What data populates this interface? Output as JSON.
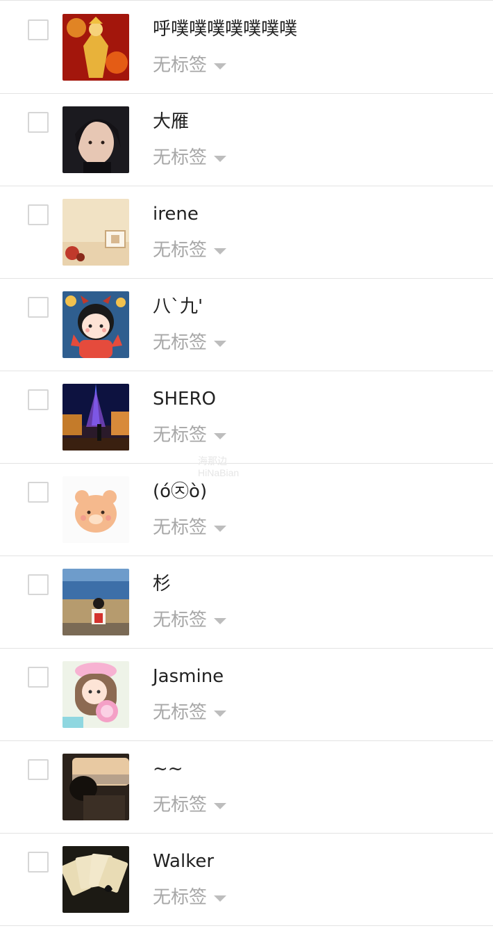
{
  "contacts": [
    {
      "name": "呼噗噗噗噗噗噗噗",
      "tag_label": "无标签",
      "avatar_icon": "golden-warrior-avatar",
      "avatar_colors": [
        "#a3160c",
        "#e8b23a"
      ]
    },
    {
      "name": "大雁",
      "tag_label": "无标签",
      "avatar_icon": "man-portrait-avatar",
      "avatar_colors": [
        "#1b1a1f",
        "#e7c7b4"
      ]
    },
    {
      "name": "irene",
      "tag_label": "无标签",
      "avatar_icon": "room-photo-avatar",
      "avatar_colors": [
        "#f1e2c4",
        "#c0392b"
      ]
    },
    {
      "name": "八`九'",
      "tag_label": "无标签",
      "avatar_icon": "cartoon-girl-avatar",
      "avatar_colors": [
        "#2f5e8f",
        "#e54b3c"
      ]
    },
    {
      "name": "SHERO",
      "tag_label": "无标签",
      "avatar_icon": "night-tower-avatar",
      "avatar_colors": [
        "#0d1240",
        "#c47b2a"
      ]
    },
    {
      "name": "(ó㉨ò)",
      "tag_label": "无标签",
      "avatar_icon": "bear-face-avatar",
      "avatar_colors": [
        "#fbfbfb",
        "#f5b98d"
      ]
    },
    {
      "name": "杉",
      "tag_label": "无标签",
      "avatar_icon": "seaside-photo-avatar",
      "avatar_colors": [
        "#3d6fa8",
        "#b69b6e"
      ]
    },
    {
      "name": "Jasmine",
      "tag_label": "无标签",
      "avatar_icon": "candy-girl-avatar",
      "avatar_colors": [
        "#eef3e8",
        "#f4a0c6"
      ]
    },
    {
      "name": "~~",
      "tag_label": "无标签",
      "avatar_icon": "train-window-avatar",
      "avatar_colors": [
        "#2b221b",
        "#e8c9a2"
      ]
    },
    {
      "name": "Walker",
      "tag_label": "无标签",
      "avatar_icon": "playing-cards-avatar",
      "avatar_colors": [
        "#1c1a14",
        "#e9dcb5"
      ]
    }
  ],
  "watermark": {
    "line1": "海那边",
    "line2": "HiNaBian"
  }
}
